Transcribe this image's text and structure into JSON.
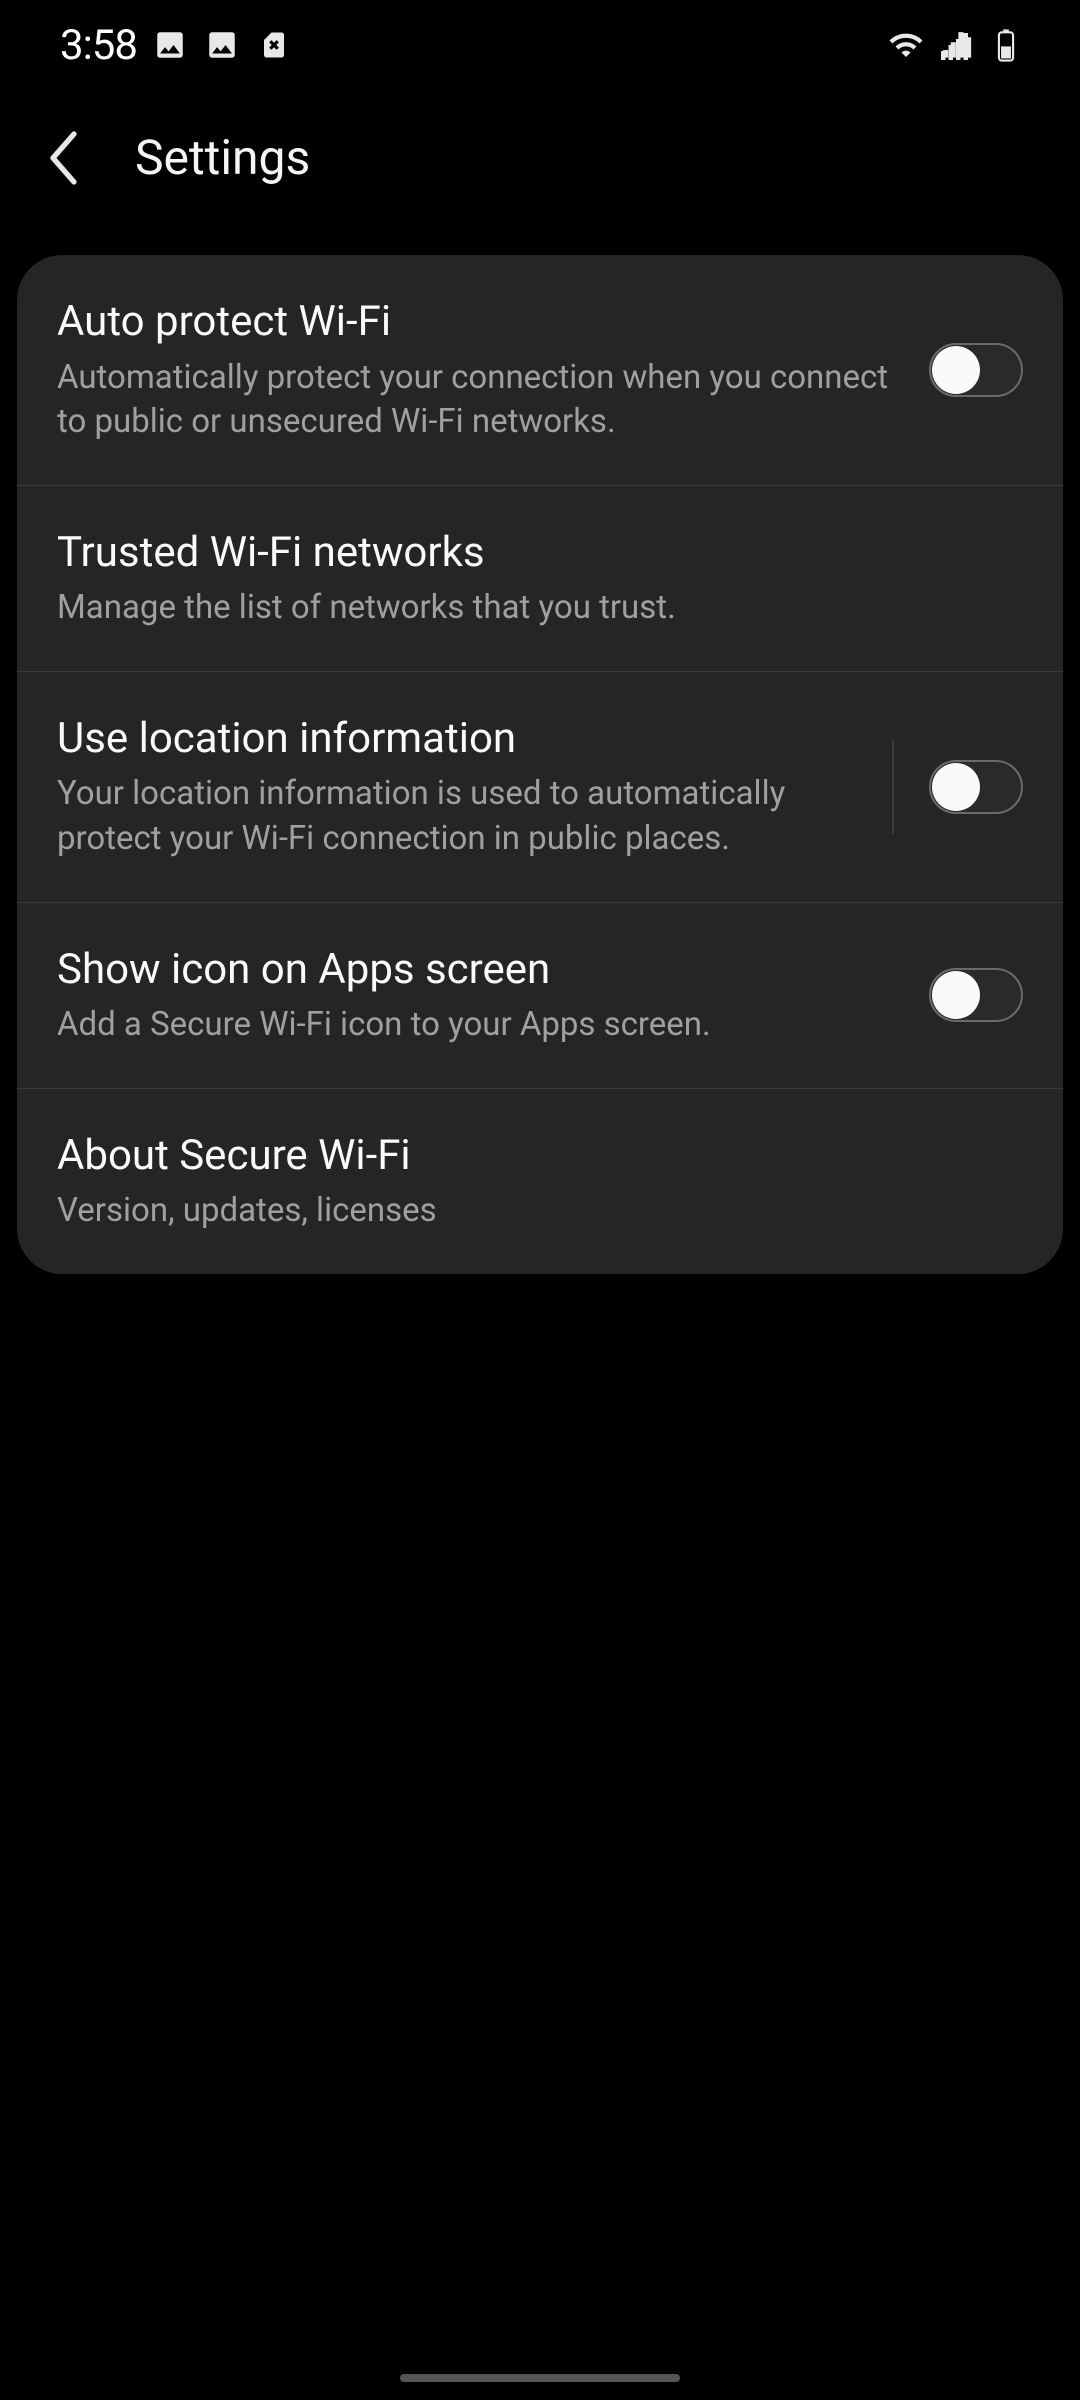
{
  "status_bar": {
    "time": "3:58"
  },
  "app_bar": {
    "title": "Settings"
  },
  "settings": [
    {
      "id": "auto-protect-wifi",
      "title": "Auto protect Wi-Fi",
      "subtitle": "Automatically protect your connection when you connect to public or unsecured Wi-Fi networks.",
      "has_toggle": true,
      "toggle_on": false,
      "has_divider": false
    },
    {
      "id": "trusted-wifi-networks",
      "title": "Trusted Wi-Fi networks",
      "subtitle": "Manage the list of networks that you trust.",
      "has_toggle": false
    },
    {
      "id": "use-location-information",
      "title": "Use location information",
      "subtitle": "Your location information is used to automatically protect your Wi-Fi connection in public places.",
      "has_toggle": true,
      "toggle_on": false,
      "has_divider": true
    },
    {
      "id": "show-icon-on-apps-screen",
      "title": "Show icon on Apps screen",
      "subtitle": "Add a Secure Wi-Fi icon to your Apps screen.",
      "has_toggle": true,
      "toggle_on": false,
      "has_divider": false
    },
    {
      "id": "about-secure-wifi",
      "title": "About Secure Wi-Fi",
      "subtitle": "Version, updates, licenses",
      "has_toggle": false
    }
  ]
}
